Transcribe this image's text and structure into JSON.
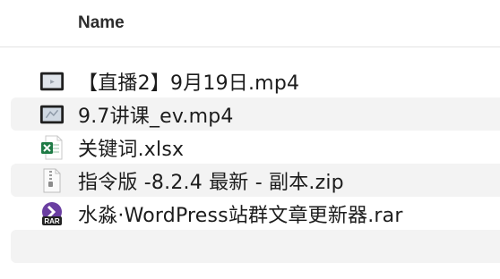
{
  "header": {
    "name_col": "Name"
  },
  "files": [
    {
      "name": "【直播2】9月19日.mp4",
      "icon": "video-file-icon"
    },
    {
      "name": "9.7讲课_ev.mp4",
      "icon": "video-file-icon"
    },
    {
      "name": "关键词.xlsx",
      "icon": "excel-file-icon"
    },
    {
      "name": "指令版 -8.2.4 最新 - 副本.zip",
      "icon": "zip-file-icon"
    },
    {
      "name": "水淼·WordPress站群文章更新器.rar",
      "icon": "rar-file-icon"
    }
  ],
  "colors": {
    "stripe": "#f3f3f3",
    "excel": "#1e7a45",
    "rar": "#6a3ea1"
  }
}
